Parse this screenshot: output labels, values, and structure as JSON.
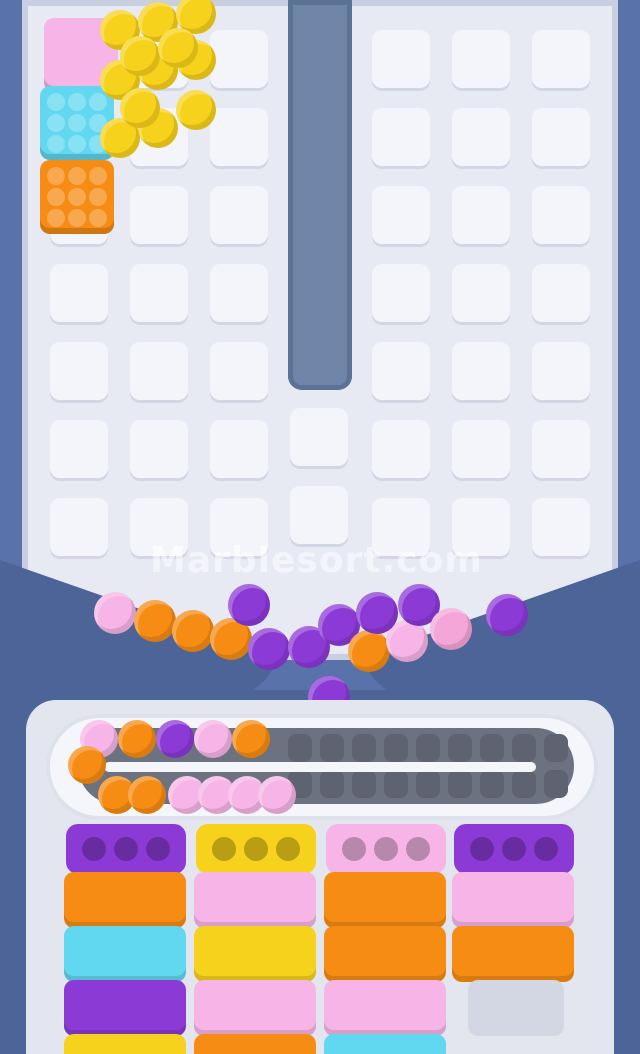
{
  "watermark": "Marblesort.com",
  "colors": {
    "yellow": "#f7d21c",
    "pink": "#f6b5e6",
    "cyan": "#62d7f0",
    "orange": "#f68c14",
    "purple": "#8c3ad6",
    "lavender": "#f5a6d8"
  },
  "stacked_blocks": [
    "pink",
    "cyan",
    "orange"
  ],
  "yellow_cluster_count": 12,
  "funnel_marbles": [
    "pink",
    "orange",
    "orange",
    "orange",
    "purple",
    "purple",
    "purple",
    "orange",
    "pink",
    "pink",
    "purple",
    "purple",
    "purple"
  ],
  "track_marbles_top": [
    "pink",
    "orange",
    "purple",
    "pink",
    "orange"
  ],
  "track_marbles_bottom": [
    "orange",
    "orange",
    "orange",
    "pink",
    "pink",
    "pink",
    "pink"
  ],
  "columns": [
    {
      "lid": "purple",
      "bricks": [
        "orange",
        "cyan",
        "purple",
        "yellow"
      ]
    },
    {
      "lid": "yellow",
      "bricks": [
        "pink",
        "yellow",
        "pink",
        "orange"
      ]
    },
    {
      "lid": "pink",
      "bricks": [
        "orange",
        "orange",
        "pink",
        "cyan"
      ]
    },
    {
      "lid": "purple",
      "bricks": [
        "pink",
        "orange",
        "empty"
      ]
    }
  ]
}
